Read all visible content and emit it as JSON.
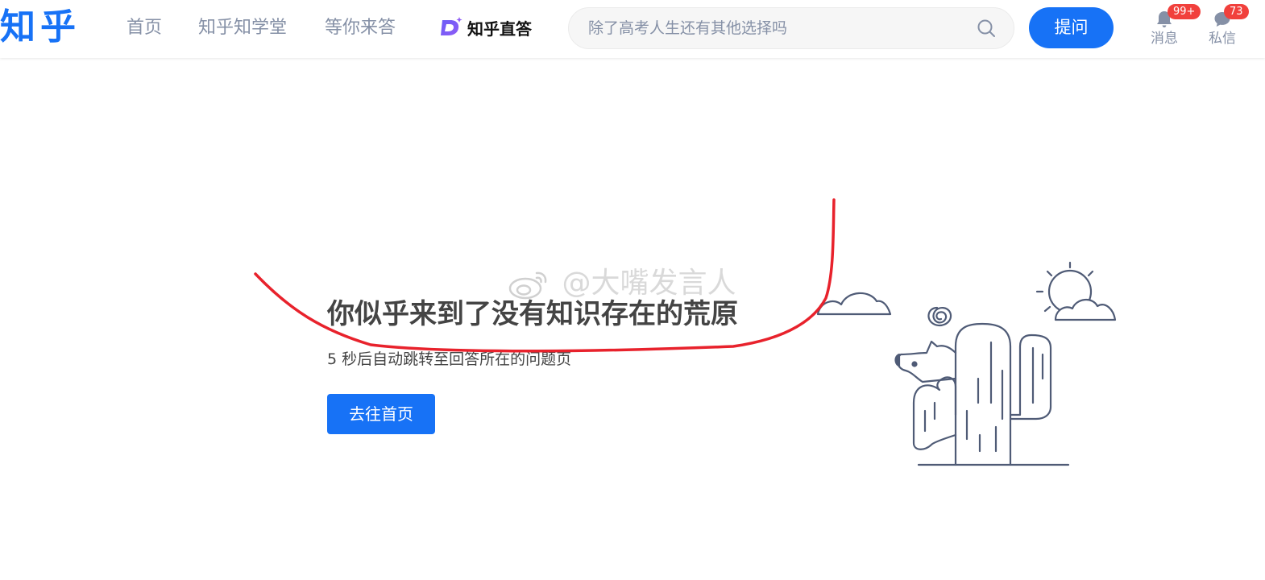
{
  "header": {
    "logo": "知乎",
    "nav": [
      {
        "label": "首页"
      },
      {
        "label": "知乎知学堂"
      },
      {
        "label": "等你来答"
      }
    ],
    "zhida_label": "知乎直答",
    "search": {
      "placeholder": "除了高考人生还有其他选择吗"
    },
    "ask_label": "提问",
    "messages": {
      "label": "消息",
      "badge": "99+"
    },
    "private_messages": {
      "label": "私信",
      "badge": "73"
    }
  },
  "main": {
    "title": "你似乎来到了没有知识存在的荒原",
    "subtitle": "5 秒后自动跳转至回答所在的问题页",
    "home_button": "去往首页"
  },
  "watermark": "@大嘴发言人",
  "colors": {
    "brand": "#1772f6",
    "badge": "#f1403c",
    "annotation": "#e8222c",
    "muted": "#8590a6"
  }
}
